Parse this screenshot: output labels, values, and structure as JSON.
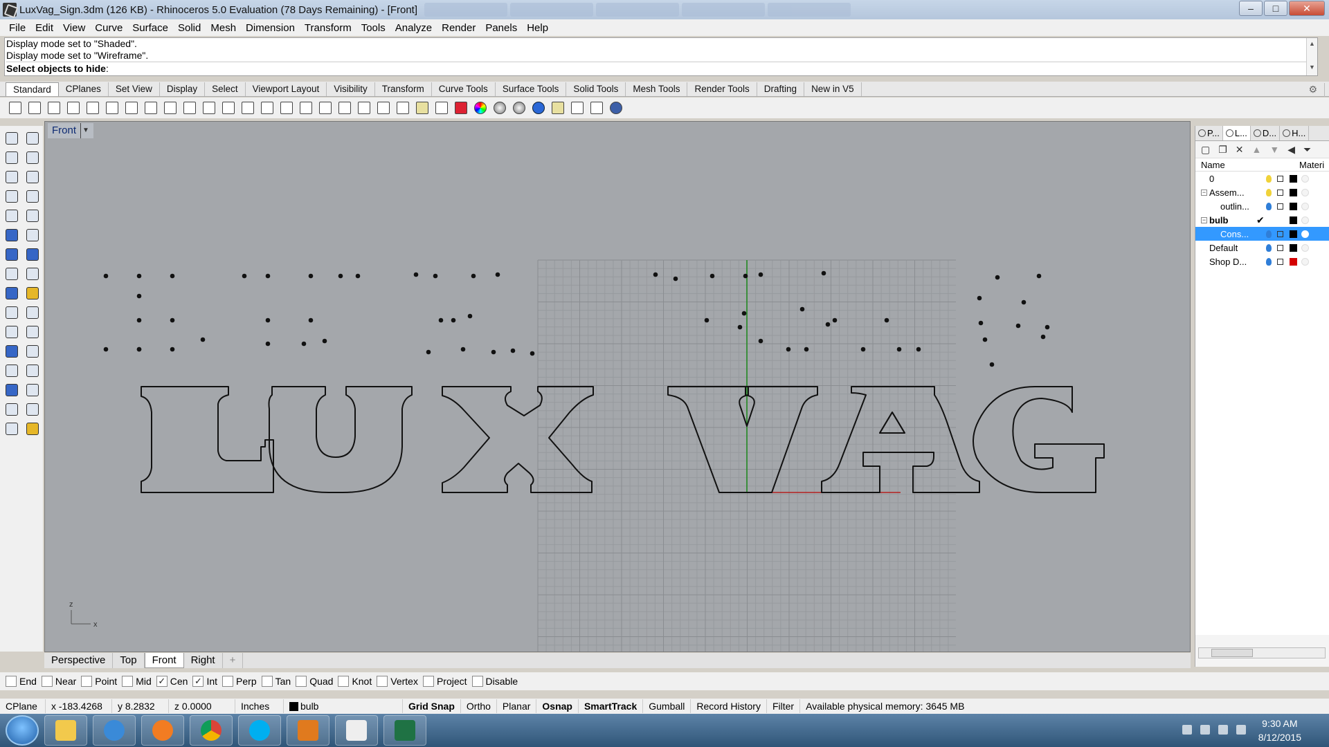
{
  "window": {
    "title": "LuxVag_Sign.3dm (126 KB) - Rhinoceros 5.0 Evaluation (78 Days Remaining) - [Front]",
    "minimize": "–",
    "maximize": "□",
    "close": "✕"
  },
  "menu": [
    "File",
    "Edit",
    "View",
    "Curve",
    "Surface",
    "Solid",
    "Mesh",
    "Dimension",
    "Transform",
    "Tools",
    "Analyze",
    "Render",
    "Panels",
    "Help"
  ],
  "command": {
    "history": [
      "Display mode set to \"Shaded\".",
      "Display mode set to \"Wireframe\"."
    ],
    "prompt": "Select objects to hide",
    "prompt_suffix": ":"
  },
  "toolbar_tabs": [
    "Standard",
    "CPlanes",
    "Set View",
    "Display",
    "Select",
    "Viewport Layout",
    "Visibility",
    "Transform",
    "Curve Tools",
    "Surface Tools",
    "Solid Tools",
    "Mesh Tools",
    "Render Tools",
    "Drafting",
    "New in V5"
  ],
  "toolbar_icons": [
    "new-file",
    "open-folder",
    "save",
    "print",
    "import",
    "cut",
    "copy",
    "paste",
    "undo",
    "pan-hand",
    "move-arrows",
    "zoom-window",
    "zoom-extents",
    "zoom-all",
    "zoom-selected",
    "rotate-view",
    "grid-4-view",
    "car-icon",
    "sketch",
    "named-view",
    "sun",
    "bulb",
    "lock",
    "shaded",
    "color-wheel",
    "sphere-gray",
    "sphere-rendered",
    "sphere-blue",
    "lamp",
    "gear-set",
    "dimension",
    "help"
  ],
  "viewport": {
    "title": "Front",
    "sign_text": "LUX VAG",
    "axis_z": "z",
    "axis_x": "x"
  },
  "viewport_tabs": [
    "Perspective",
    "Top",
    "Front",
    "Right"
  ],
  "viewport_tab_active": "Front",
  "osnaps": [
    {
      "label": "End",
      "checked": false
    },
    {
      "label": "Near",
      "checked": false
    },
    {
      "label": "Point",
      "checked": false
    },
    {
      "label": "Mid",
      "checked": false
    },
    {
      "label": "Cen",
      "checked": true
    },
    {
      "label": "Int",
      "checked": true
    },
    {
      "label": "Perp",
      "checked": false
    },
    {
      "label": "Tan",
      "checked": false
    },
    {
      "label": "Quad",
      "checked": false
    },
    {
      "label": "Knot",
      "checked": false
    },
    {
      "label": "Vertex",
      "checked": false
    },
    {
      "label": "Project",
      "checked": false
    },
    {
      "label": "Disable",
      "checked": false
    }
  ],
  "status": {
    "cplane": "CPlane",
    "x": "x -183.4268",
    "y": "y 8.2832",
    "z": "z 0.0000",
    "units": "Inches",
    "layer": "bulb",
    "grid_snap": "Grid Snap",
    "ortho": "Ortho",
    "planar": "Planar",
    "osnap": "Osnap",
    "smarttrack": "SmartTrack",
    "gumball": "Gumball",
    "record_history": "Record History",
    "filter": "Filter",
    "memory": "Available physical memory: 3645 MB"
  },
  "panel": {
    "tabs": [
      "P...",
      "L...",
      "D...",
      "H..."
    ],
    "header_name": "Name",
    "header_material": "Materi",
    "layers": [
      {
        "name": "0",
        "indent": 0,
        "expander": "",
        "current": false,
        "bulb_on": true,
        "color": "#000000",
        "selected": false,
        "bold": false
      },
      {
        "name": "Assem...",
        "indent": 0,
        "expander": "−",
        "current": false,
        "bulb_on": true,
        "color": "#000000",
        "selected": false,
        "bold": false
      },
      {
        "name": "outlin...",
        "indent": 1,
        "expander": "",
        "current": false,
        "bulb_on": false,
        "color": "#000000",
        "selected": false,
        "bold": false
      },
      {
        "name": "bulb",
        "indent": 0,
        "expander": "−",
        "current": true,
        "bulb_on": false,
        "color": "#000000",
        "selected": false,
        "bold": true
      },
      {
        "name": "Cons...",
        "indent": 1,
        "expander": "",
        "current": false,
        "bulb_on": false,
        "color": "#000000",
        "selected": true,
        "bold": false
      },
      {
        "name": "Default",
        "indent": 0,
        "expander": "",
        "current": false,
        "bulb_on": false,
        "color": "#000000",
        "selected": false,
        "bold": false
      },
      {
        "name": "Shop D...",
        "indent": 0,
        "expander": "",
        "current": false,
        "bulb_on": false,
        "color": "#d40000",
        "selected": false,
        "bold": false
      }
    ],
    "current_mark": "✔"
  },
  "taskbar": {
    "time": "9:30 AM",
    "date": "8/12/2015"
  }
}
